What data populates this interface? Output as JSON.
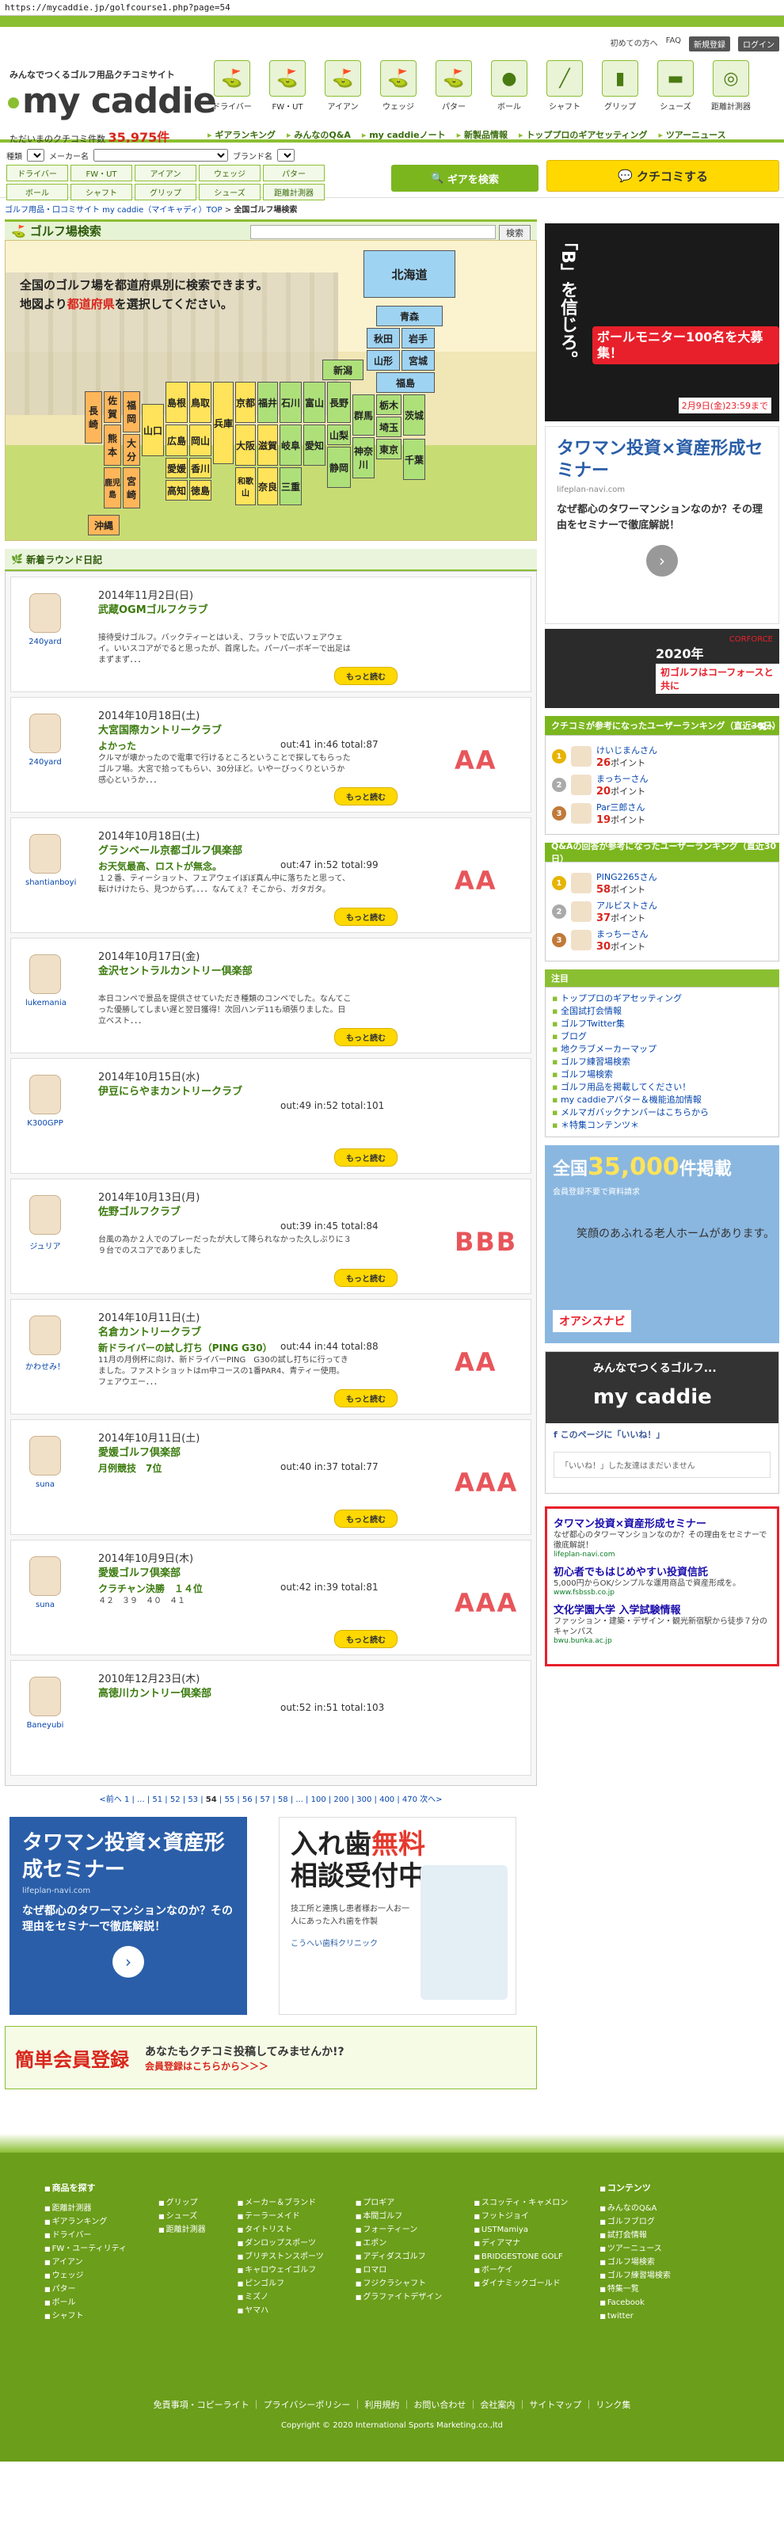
{
  "url": "https://mycaddie.jp/golfcourse1.php?page=54",
  "header": {
    "util_links": [
      "初めての方へ",
      "FAQ",
      "新規登録",
      "ログイン"
    ],
    "tagline": "みんなでつくるゴルフ用品クチコミサイト",
    "logo": "my caddie",
    "count_prefix": "ただいまのクチコミ件数",
    "count_value": "35,975件",
    "categories": [
      "ドライバー",
      "FW・UT",
      "アイアン",
      "ウェッジ",
      "パター",
      "ボール",
      "シャフト",
      "グリップ",
      "シューズ",
      "距離計測器"
    ],
    "nav": [
      "ギアランキング",
      "みんなのQ&A",
      "my caddieノート",
      "新製品情報",
      "トッププロのギアセッティング",
      "ツアーニュース"
    ]
  },
  "search": {
    "label_kind": "種類",
    "label_maker": "メーカー名",
    "label_brand": "ブランド名",
    "gear_buttons": [
      "ドライバー",
      "FW・UT",
      "アイアン",
      "ウェッジ",
      "パター",
      "ボール",
      "シャフト",
      "グリップ",
      "シューズ",
      "距離計測器"
    ],
    "gear_search": "ギアを検索",
    "kuchikomi": "クチコミする"
  },
  "breadcrumb": {
    "root": "ゴルフ用品・口コミサイト my caddie（マイキャディ）TOP",
    "current": "全国ゴルフ場検索"
  },
  "course_search": {
    "title": "ゴルフ場検索",
    "button": "検索",
    "intro_line1": "全国のゴルフ場を都道府県別に検索できます。",
    "intro_line2a": "地図より",
    "intro_em": "都道府県",
    "intro_line2b": "を選択してください。",
    "prefectures": {
      "hokkaido": "北海道",
      "aomori": "青森",
      "akita": "秋田",
      "iwate": "岩手",
      "yamagata": "山形",
      "miyagi": "宮城",
      "fukushima": "福島",
      "niigata": "新潟",
      "toyama": "富山",
      "ishikawa": "石川",
      "fukui": "福井",
      "nagano": "長野",
      "gifu": "岐阜",
      "gunma": "群馬",
      "tochigi": "栃木",
      "ibaraki": "茨城",
      "saitama": "埼玉",
      "tokyo": "東京",
      "chiba": "千葉",
      "kanagawa": "神奈川",
      "yamanashi": "山梨",
      "shizuoka": "静岡",
      "aichi": "愛知",
      "mie": "三重",
      "shiga": "滋賀",
      "kyoto": "京都",
      "osaka": "大阪",
      "nara": "奈良",
      "wakayama": "和歌山",
      "hyogo": "兵庫",
      "tottori": "鳥取",
      "shimane": "島根",
      "okayama": "岡山",
      "hiroshima": "広島",
      "yamaguchi": "山口",
      "kagawa": "香川",
      "tokushima": "徳島",
      "ehime": "愛媛",
      "kochi": "高知",
      "fukuoka": "福岡",
      "saga": "佐賀",
      "nagasaki": "長崎",
      "kumamoto": "熊本",
      "oita": "大分",
      "miyazaki": "宮崎",
      "kagoshima": "鹿児島",
      "okinawa": "沖縄"
    }
  },
  "diary": {
    "title": "新着ラウンド日記",
    "more_label": "もっと読む",
    "rounds": [
      {
        "user": "240yard",
        "date": "2014年11月2日(日)",
        "course": "武蔵OGMゴルフクラブ",
        "title": "",
        "score": "",
        "body": "接待受けゴルフ。バックティーとはいえ、フラットで広いフェアウェイ。いいスコアがでると思ったが、首席した。パーパーボギーで出足はまずまず．．．",
        "rank": ""
      },
      {
        "user": "240yard",
        "date": "2014年10月18日(土)",
        "course": "大宮国際カントリークラブ",
        "title": "よかった",
        "score": "out:41  in:46  total:87",
        "body": "クルマが壊かったので電車で行けるところということで探してもらったゴルフ場。大宮で拾ってもらい、30分ほど。いやーびっくりというか感心というか．．．",
        "rank": "AA"
      },
      {
        "user": "shantianboyi",
        "date": "2014年10月18日(土)",
        "course": "グランベール京都ゴルフ倶楽部",
        "title": "お天気最高、ロストが無念。",
        "score": "out:47  in:52  total:99",
        "body": "１２番、ティーショット、フェアウェイぼぼ真ん中に落ちたと思って、転けけけたら、見つからず。．．．なんてぇ？そこから、ガタガタ。",
        "rank": "AA"
      },
      {
        "user": "lukemania",
        "date": "2014年10月17日(金)",
        "course": "金沢セントラルカントリー倶楽部",
        "title": "",
        "score": "",
        "body": "本日コンペで景品を提供させていただき種類のコンペでした。なんてこった優勝してしまい遅と翌日獲得！次回ハンデ11も頑張りました。日立ベスト．．．",
        "rank": ""
      },
      {
        "user": "K300GPP",
        "date": "2014年10月15日(水)",
        "course": "伊豆にらやまカントリークラブ",
        "title": "",
        "score": "out:49  in:52  total:101",
        "body": "",
        "rank": ""
      },
      {
        "user": "ジュリア",
        "date": "2014年10月13日(月)",
        "course": "佐野ゴルフクラブ",
        "title": "",
        "score": "out:39  in:45  total:84",
        "body": "台風の為か２人でのプレーだったが大して降られなかった久しぶりに３９台でのスコアでありました",
        "rank": "BBB"
      },
      {
        "user": "かわせみ！",
        "date": "2014年10月11日(土)",
        "course": "名倉カントリークラブ",
        "title": "新ドライバーの試し打ち（PING G30）",
        "score": "out:44  in:44  total:88",
        "body": "11月の月例杯に向け、新ドライバーPING　G30の試し打ちに行ってきました。ファストショットはｍ中コースの1番PAR4、青ティー使用。フェアウエー．．．",
        "rank": "AA"
      },
      {
        "user": "suna",
        "date": "2014年10月11日(土)",
        "course": "愛媛ゴルフ倶楽部",
        "title": "月例競技　7位",
        "score": "out:40  in:37  total:77",
        "body": "",
        "rank": "AAA"
      },
      {
        "user": "suna",
        "date": "2014年10月9日(木)",
        "course": "愛媛ゴルフ倶楽部",
        "title": "クラチャン決勝　１４位",
        "score": "out:42  in:39  total:81",
        "body": "４２　３９　４０　４１",
        "rank": "AAA"
      },
      {
        "user": "Baneyubi",
        "date": "2010年12月23日(木)",
        "course": "高徳川カントリー倶楽部",
        "title": "",
        "score": "out:52  in:51  total:103",
        "body": "",
        "rank": ""
      }
    ]
  },
  "pager": {
    "prev": "<前へ",
    "pages": [
      "1",
      "...",
      "51",
      "52",
      "53",
      "54",
      "55",
      "56",
      "57",
      "58",
      "...",
      "100",
      "200",
      "300",
      "400",
      "470"
    ],
    "current": "54",
    "next": "次へ>"
  },
  "ads": {
    "tower_t1": "タワマン投資×資産形成セミナー",
    "tower_t2": "lifeplan-navi.com",
    "tower_t3": "なぜ都心のタワーマンションなのか？その理由をセミナーで徹底解説！",
    "dental_t1a": "入れ歯",
    "dental_t1b": "無料",
    "dental_t1c": "相談受付中",
    "dental_t2": "技工所と連携し患者様お一人お一人にあった入れ歯を作製",
    "dental_t3": "こうへい歯科クリニック",
    "reg_a": "簡単会員登録",
    "reg_b": "あなたもクチコミ投稿してみませんか!?",
    "reg_c": "会員登録はこちらから＞＞＞"
  },
  "side": {
    "ad1_vt": "「B」を信じろ。",
    "ad1_badge": "ボールモニター100名を大募集！",
    "ad1_date": "2月9日(金)23:59まで",
    "ad3_t1": "2020年",
    "ad3_t2": "初ゴルフはコーフォースと共に",
    "ad3_t3": "CORFORCE",
    "ranking1_title": "クチコミが参考になったユーザーランキング（直近30日）",
    "ranking1_more": "一覧へ",
    "ranking1": [
      {
        "rank": "1",
        "name": "けいじまんさん",
        "pt": "26",
        "unit": "ポイント"
      },
      {
        "rank": "2",
        "name": "まっちーさん",
        "pt": "20",
        "unit": "ポイント"
      },
      {
        "rank": "3",
        "name": "Par三郎さん",
        "pt": "19",
        "unit": "ポイント"
      }
    ],
    "ranking2_title": "Q&Aの回答が参考になったユーザーランキング（直近30日）",
    "ranking2": [
      {
        "rank": "1",
        "name": "PING2265さん",
        "pt": "58",
        "unit": "ポイント"
      },
      {
        "rank": "2",
        "name": "アルビストさん",
        "pt": "37",
        "unit": "ポイント"
      },
      {
        "rank": "3",
        "name": "まっちーさん",
        "pt": "30",
        "unit": "ポイント"
      }
    ],
    "notice_title": "注目",
    "notices": [
      "トッププロのギアセッティング",
      "全国試打会情報",
      "ゴルフTwitter集",
      "ブログ",
      "地クラブメーカーマップ",
      "ゴルフ練習場検索",
      "ゴルフ場検索",
      "ゴルフ用品を掲載してください！",
      "my caddieアバター＆機能追加情報",
      "メルマガバックナンバーはこちらから",
      "＊特集コンテンツ＊"
    ],
    "ad4_t1a": "全国",
    "ad4_t1b": "35,000",
    "ad4_t1c": "件掲載",
    "ad4_t2": "会員登録不要で資料請求",
    "ad4_t3": "笑顔のあふれる老人ホームがあります。",
    "ad4_t4": "オアシスナビ",
    "fb_t1": "みんなでつくるゴルフ...",
    "fb_t2": "my caddie",
    "fb_like": "このページに「いいね！」",
    "fb_msg": "「いいね！」した友達はまだいません",
    "text_ads": [
      {
        "h": "タワマン投資×資産形成セミナー",
        "d": "なぜ都心のタワーマンションなのか？その理由をセミナーで徹底解説！",
        "u": "lifeplan-navi.com"
      },
      {
        "h": "初心者でもはじめやすい投資信託",
        "d": "5,000円からOK/シンプルな運用商品で資産形成を。",
        "u": "www.fsbssb.co.jp"
      },
      {
        "h": "文化学園大学 入学試験情報",
        "d": "ファッション・建築・デザイン・観光新宿駅から徒歩７分のキャンパス",
        "u": "bwu.bunka.ac.jp"
      }
    ]
  },
  "footer": {
    "cols": [
      {
        "head": "商品を探す",
        "items": [
          "距離計測器",
          "ギアランキング",
          "ドライバー",
          "FW・ユーティリティ",
          "アイアン",
          "ウェッジ",
          "パター",
          "ボール",
          "シャフト"
        ]
      },
      {
        "head": "",
        "items": [
          "グリップ",
          "シューズ",
          "距離計測器"
        ]
      },
      {
        "head": "",
        "items": [
          "メーカー＆ブランド",
          "テーラーメイド",
          "タイトリスト",
          "ダンロップスポーツ",
          "ブリヂストンスポーツ",
          "キャロウェイゴルフ",
          "ピンゴルフ",
          "ミズノ",
          "ヤマハ"
        ]
      },
      {
        "head": "",
        "items": [
          "プロギア",
          "本間ゴルフ",
          "フォーティーン",
          "エポン",
          "アディダスゴルフ",
          "ロマロ",
          "フジクラシャフト",
          "グラファイトデザイン"
        ]
      },
      {
        "head": "",
        "items": [
          "スコッティ・キャメロン",
          "フットジョイ",
          "USTMamiya",
          "ディアマナ",
          "BRIDGESTONE GOLF",
          "ボーケイ",
          "ダイナミックゴールド"
        ]
      },
      {
        "head": "コンテンツ",
        "items": [
          "みんなのQ&A",
          "ゴルフブログ",
          "試打会情報",
          "ツアーニュース",
          "ゴルフ場検索",
          "ゴルフ練習場検索",
          "特集一覧",
          "Facebook",
          "twitter"
        ]
      }
    ],
    "links": "免責事項・コピーライト ｜ プライバシーポリシー ｜ 利用規約 ｜ お問い合わせ ｜ 会社案内 ｜ サイトマップ ｜ リンク集",
    "copy": "Copyright © 2020 International Sports Marketing.co.,ltd"
  }
}
